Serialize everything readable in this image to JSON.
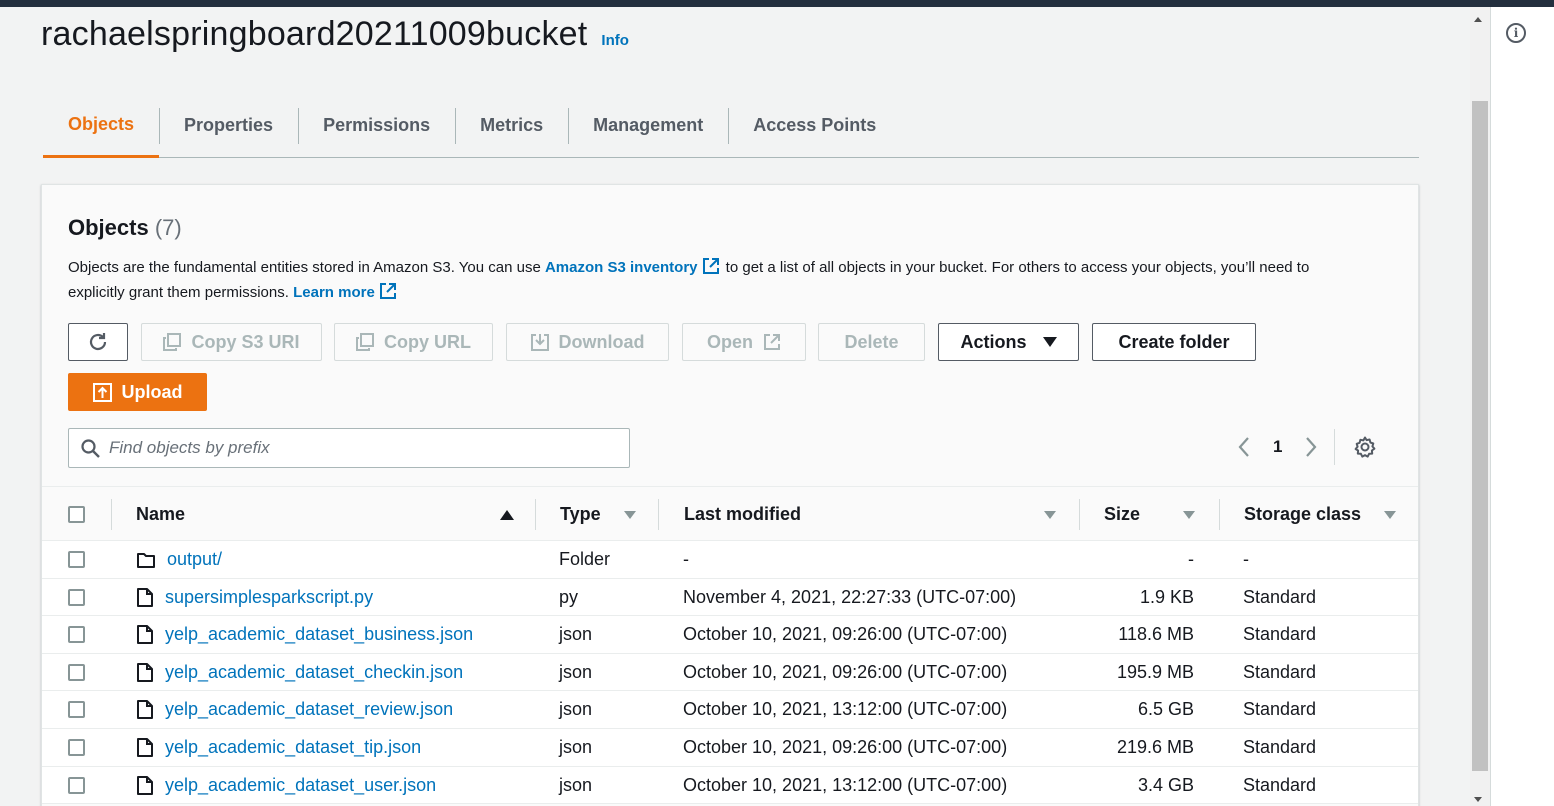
{
  "bucket": {
    "title": "rachaelspringboard20211009bucket",
    "info_link": "Info"
  },
  "tabs": [
    {
      "label": "Objects",
      "active": true
    },
    {
      "label": "Properties"
    },
    {
      "label": "Permissions"
    },
    {
      "label": "Metrics"
    },
    {
      "label": "Management"
    },
    {
      "label": "Access Points"
    }
  ],
  "objects_panel": {
    "title": "Objects",
    "count": "(7)",
    "desc_part1": "Objects are the fundamental entities stored in Amazon S3. You can use ",
    "desc_link1": "Amazon S3 inventory",
    "desc_part2": " to get a list of all objects in your bucket. For others to access your objects, you’ll need to explicitly grant them permissions. ",
    "desc_link2": "Learn more"
  },
  "toolbar": {
    "copy_s3_uri": "Copy S3 URI",
    "copy_url": "Copy URL",
    "download": "Download",
    "open": "Open",
    "delete": "Delete",
    "actions": "Actions",
    "create_folder": "Create folder",
    "upload": "Upload"
  },
  "search": {
    "placeholder": "Find objects by prefix"
  },
  "pagination": {
    "page": "1"
  },
  "columns": {
    "name": "Name",
    "type": "Type",
    "last_modified": "Last modified",
    "size": "Size",
    "storage_class": "Storage class"
  },
  "rows": [
    {
      "name": "output/",
      "icon": "folder-icon",
      "type": "Folder",
      "last_modified": "-",
      "size": "-",
      "storage_class": "-"
    },
    {
      "name": "supersimplesparkscript.py",
      "icon": "file-icon",
      "type": "py",
      "last_modified": "November 4, 2021, 22:27:33 (UTC-07:00)",
      "size": "1.9 KB",
      "storage_class": "Standard"
    },
    {
      "name": "yelp_academic_dataset_business.json",
      "icon": "file-icon",
      "type": "json",
      "last_modified": "October 10, 2021, 09:26:00 (UTC-07:00)",
      "size": "118.6 MB",
      "storage_class": "Standard"
    },
    {
      "name": "yelp_academic_dataset_checkin.json",
      "icon": "file-icon",
      "type": "json",
      "last_modified": "October 10, 2021, 09:26:00 (UTC-07:00)",
      "size": "195.9 MB",
      "storage_class": "Standard"
    },
    {
      "name": "yelp_academic_dataset_review.json",
      "icon": "file-icon",
      "type": "json",
      "last_modified": "October 10, 2021, 13:12:00 (UTC-07:00)",
      "size": "6.5 GB",
      "storage_class": "Standard"
    },
    {
      "name": "yelp_academic_dataset_tip.json",
      "icon": "file-icon",
      "type": "json",
      "last_modified": "October 10, 2021, 09:26:00 (UTC-07:00)",
      "size": "219.6 MB",
      "storage_class": "Standard"
    },
    {
      "name": "yelp_academic_dataset_user.json",
      "icon": "file-icon",
      "type": "json",
      "last_modified": "October 10, 2021, 13:12:00 (UTC-07:00)",
      "size": "3.4 GB",
      "storage_class": "Standard"
    }
  ],
  "colors": {
    "accent": "#ec7211",
    "link": "#0073bb",
    "topbar": "#232f3e"
  }
}
